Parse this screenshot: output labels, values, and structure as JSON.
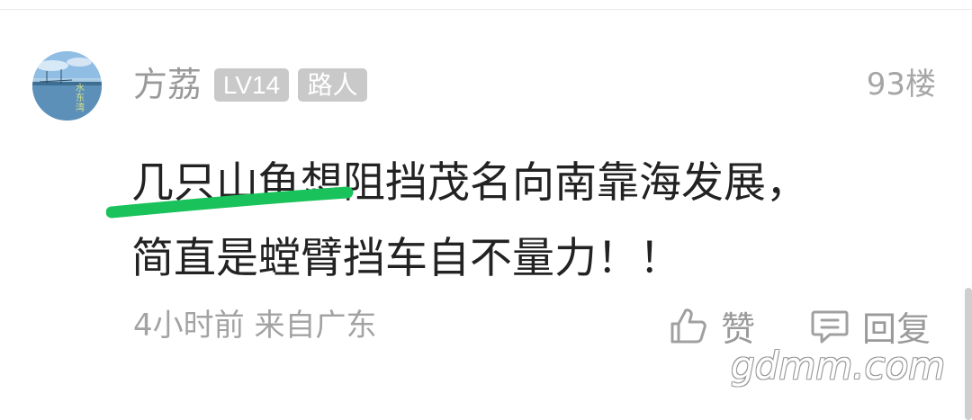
{
  "comment": {
    "username": "方荔",
    "level_badge": "LV14",
    "role_badge": "路人",
    "floor": "93楼",
    "avatar_caption": "水东湾",
    "content_lines": [
      "几只山龟想阻挡茂名向南靠海发展，",
      "简直是螳臂挡车自不量力！！"
    ],
    "time_location": "4小时前 来自广东",
    "like_label": "赞",
    "reply_label": "回复"
  },
  "watermark": "gdmm.com",
  "colors": {
    "badge_bg": "#c9c9c9",
    "highlight_stroke": "#19c25a",
    "secondary_text": "#9a9a9a"
  },
  "icons": [
    "thumbs-up-icon",
    "comment-icon"
  ]
}
